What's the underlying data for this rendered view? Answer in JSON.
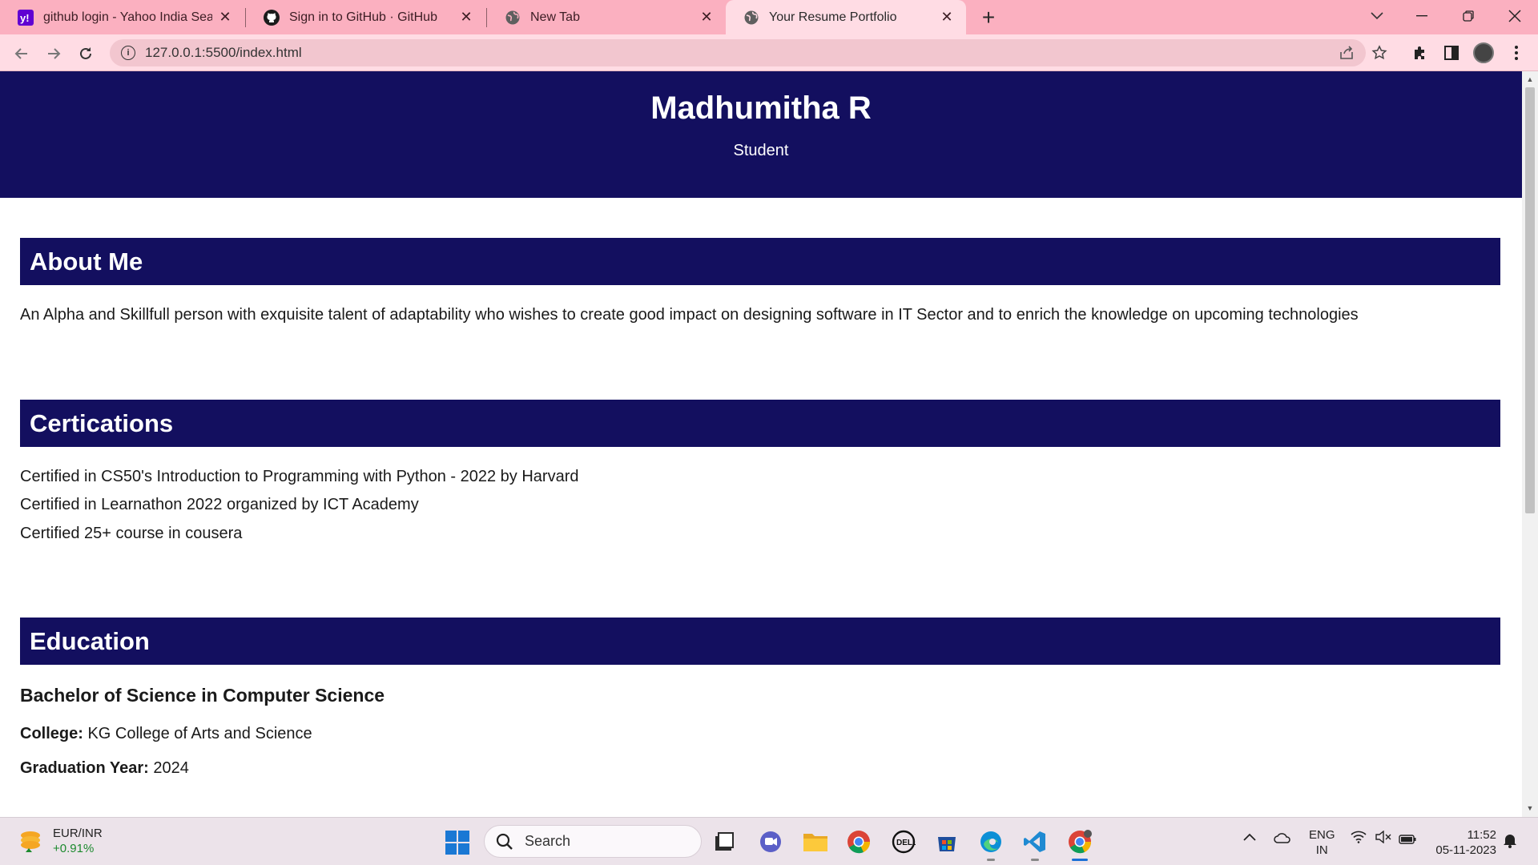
{
  "browser": {
    "tabs": [
      {
        "title": "github login - Yahoo India Searc",
        "icon": "yahoo-icon",
        "active": false
      },
      {
        "title": "Sign in to GitHub · GitHub",
        "icon": "github-icon",
        "active": false
      },
      {
        "title": "New Tab",
        "icon": "globe-icon",
        "active": false
      },
      {
        "title": "Your Resume Portfolio",
        "icon": "globe-icon",
        "active": true
      }
    ],
    "url": "127.0.0.1:5500/index.html"
  },
  "page": {
    "header": {
      "name": "Madhumitha R",
      "role": "Student"
    },
    "about": {
      "heading": "About Me",
      "text": "An Alpha and Skillfull person with exquisite talent of adaptability who wishes to create good impact on designing software in IT Sector and to enrich the knowledge on upcoming technologies"
    },
    "certifications": {
      "heading": "Certications",
      "items": [
        "Certified in CS50's Introduction to Programming with Python - 2022 by Harvard",
        "Certified in Learnathon 2022 organized by ICT Academy",
        "Certified 25+ course in cousera"
      ]
    },
    "education": {
      "heading": "Education",
      "degree": "Bachelor of Science in Computer Science",
      "college_label": "College:",
      "college": "KG College of Arts and Science",
      "year_label": "Graduation Year:",
      "year": "2024"
    }
  },
  "taskbar": {
    "weather": {
      "pair": "EUR/INR",
      "change": "+0.91%"
    },
    "search_placeholder": "Search",
    "lang": {
      "line1": "ENG",
      "line2": "IN"
    },
    "clock": {
      "time": "11:52",
      "date": "05-11-2023"
    }
  },
  "colors": {
    "header_bg": "#130f5f",
    "tabstrip": "#fbb0c0",
    "toolbar": "#ffdce4"
  }
}
